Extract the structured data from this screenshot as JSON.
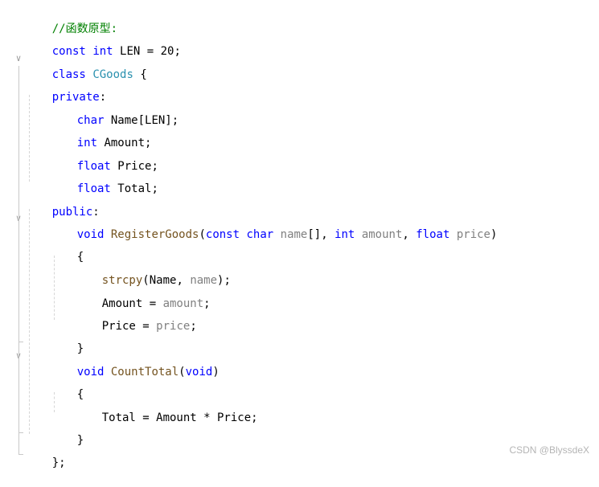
{
  "colors": {
    "keyword": "#0000ff",
    "class_name": "#2b91af",
    "comment": "#008000",
    "function_name": "#74531f",
    "parameter": "#808080",
    "text": "#000000"
  },
  "icons": {
    "fold": "chevron-down-icon"
  },
  "code": {
    "l1": {
      "comment": "//函数原型:"
    },
    "l2": {
      "kw_const": "const",
      "kw_int": "int",
      "rest": " LEN = 20;"
    },
    "l3": {
      "kw_class": "class",
      "class_name": "CGoods",
      "rest": " {"
    },
    "l4": {
      "kw_private": "private",
      "colon": ":"
    },
    "l5": {
      "kw_char": "char",
      "rest": " Name[LEN];"
    },
    "l6": {
      "kw_int": "int",
      "rest": " Amount;"
    },
    "l7": {
      "kw_float": "float",
      "rest": " Price;"
    },
    "l8": {
      "kw_float": "float",
      "rest": " Total;"
    },
    "l9": {
      "kw_public": "public",
      "colon": ":"
    },
    "l10": {
      "kw_void": "void",
      "fn": "RegisterGoods",
      "open": "(",
      "kw_const": "const",
      "kw_char": "char",
      "p_name": "name",
      "t1": "[], ",
      "kw_int": "int",
      "p_amount": "amount",
      "t2": ", ",
      "kw_float": "float",
      "p_price": "price",
      "close": ")"
    },
    "l11": {
      "text": "{"
    },
    "l12": {
      "fn": "strcpy",
      "t1": "(Name, ",
      "p_name": "name",
      "t2": ");"
    },
    "l13": {
      "t1": "Amount = ",
      "p_amount": "amount",
      "t2": ";"
    },
    "l14": {
      "t1": "Price = ",
      "p_price": "price",
      "t2": ";"
    },
    "l15": {
      "text": "}"
    },
    "l16": {
      "kw_void": "void",
      "fn": "CountTotal",
      "open": "(",
      "kw_void2": "void",
      "close": ")"
    },
    "l17": {
      "text": "{"
    },
    "l18": {
      "text": "Total = Amount * Price;"
    },
    "l19": {
      "text": "}"
    },
    "l20": {
      "text": "};"
    }
  },
  "watermark": "CSDN @BlyssdeX"
}
